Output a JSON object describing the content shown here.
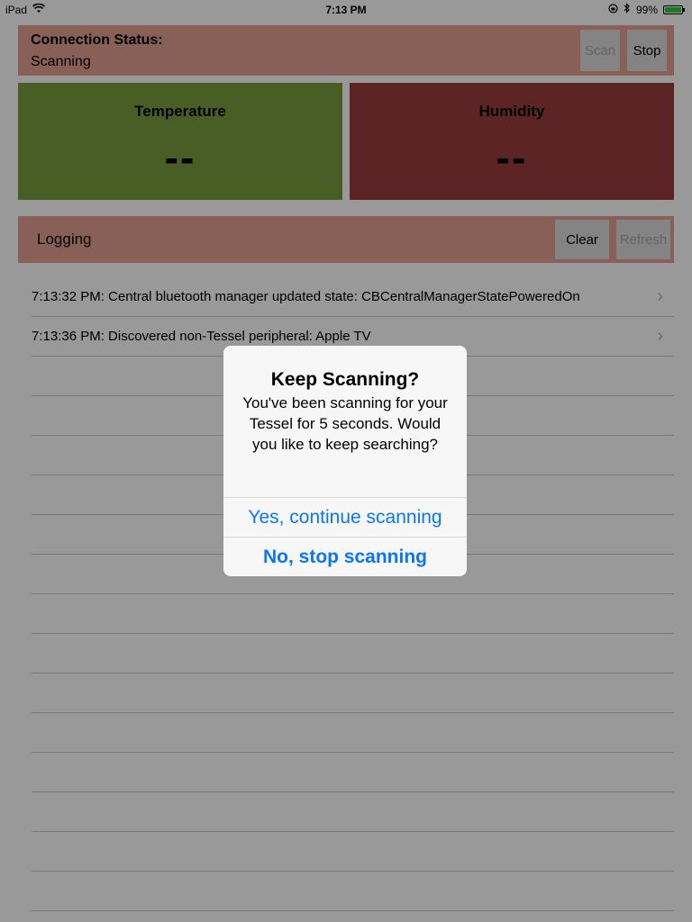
{
  "status_bar": {
    "device": "iPad",
    "time": "7:13 PM",
    "battery": "99%",
    "icons": [
      "wifi-icon",
      "rotation-lock-icon",
      "bluetooth-icon",
      "battery-icon"
    ]
  },
  "connection": {
    "label": "Connection Status:",
    "value": "Scanning",
    "scan_button": "Scan",
    "stop_button": "Stop"
  },
  "tiles": {
    "temperature": {
      "title": "Temperature",
      "value": "--",
      "color": "#7b9d3e"
    },
    "humidity": {
      "title": "Humidity",
      "value": "--",
      "color": "#993d3d"
    }
  },
  "logging": {
    "label": "Logging",
    "clear_button": "Clear",
    "refresh_button": "Refresh"
  },
  "log_entries": [
    "7:13:32 PM: Central bluetooth manager updated state: CBCentralManagerStatePoweredOn",
    "7:13:36 PM: Discovered non-Tessel peripheral: Apple TV"
  ],
  "alert": {
    "title": "Keep Scanning?",
    "message": "You've been scanning for your Tessel for 5 seconds. Would you like to keep searching?",
    "continue_button": "Yes, continue scanning",
    "stop_button": "No, stop scanning"
  },
  "colors": {
    "panel_bg": "#e3a091",
    "accent_blue": "#0a76f6"
  }
}
